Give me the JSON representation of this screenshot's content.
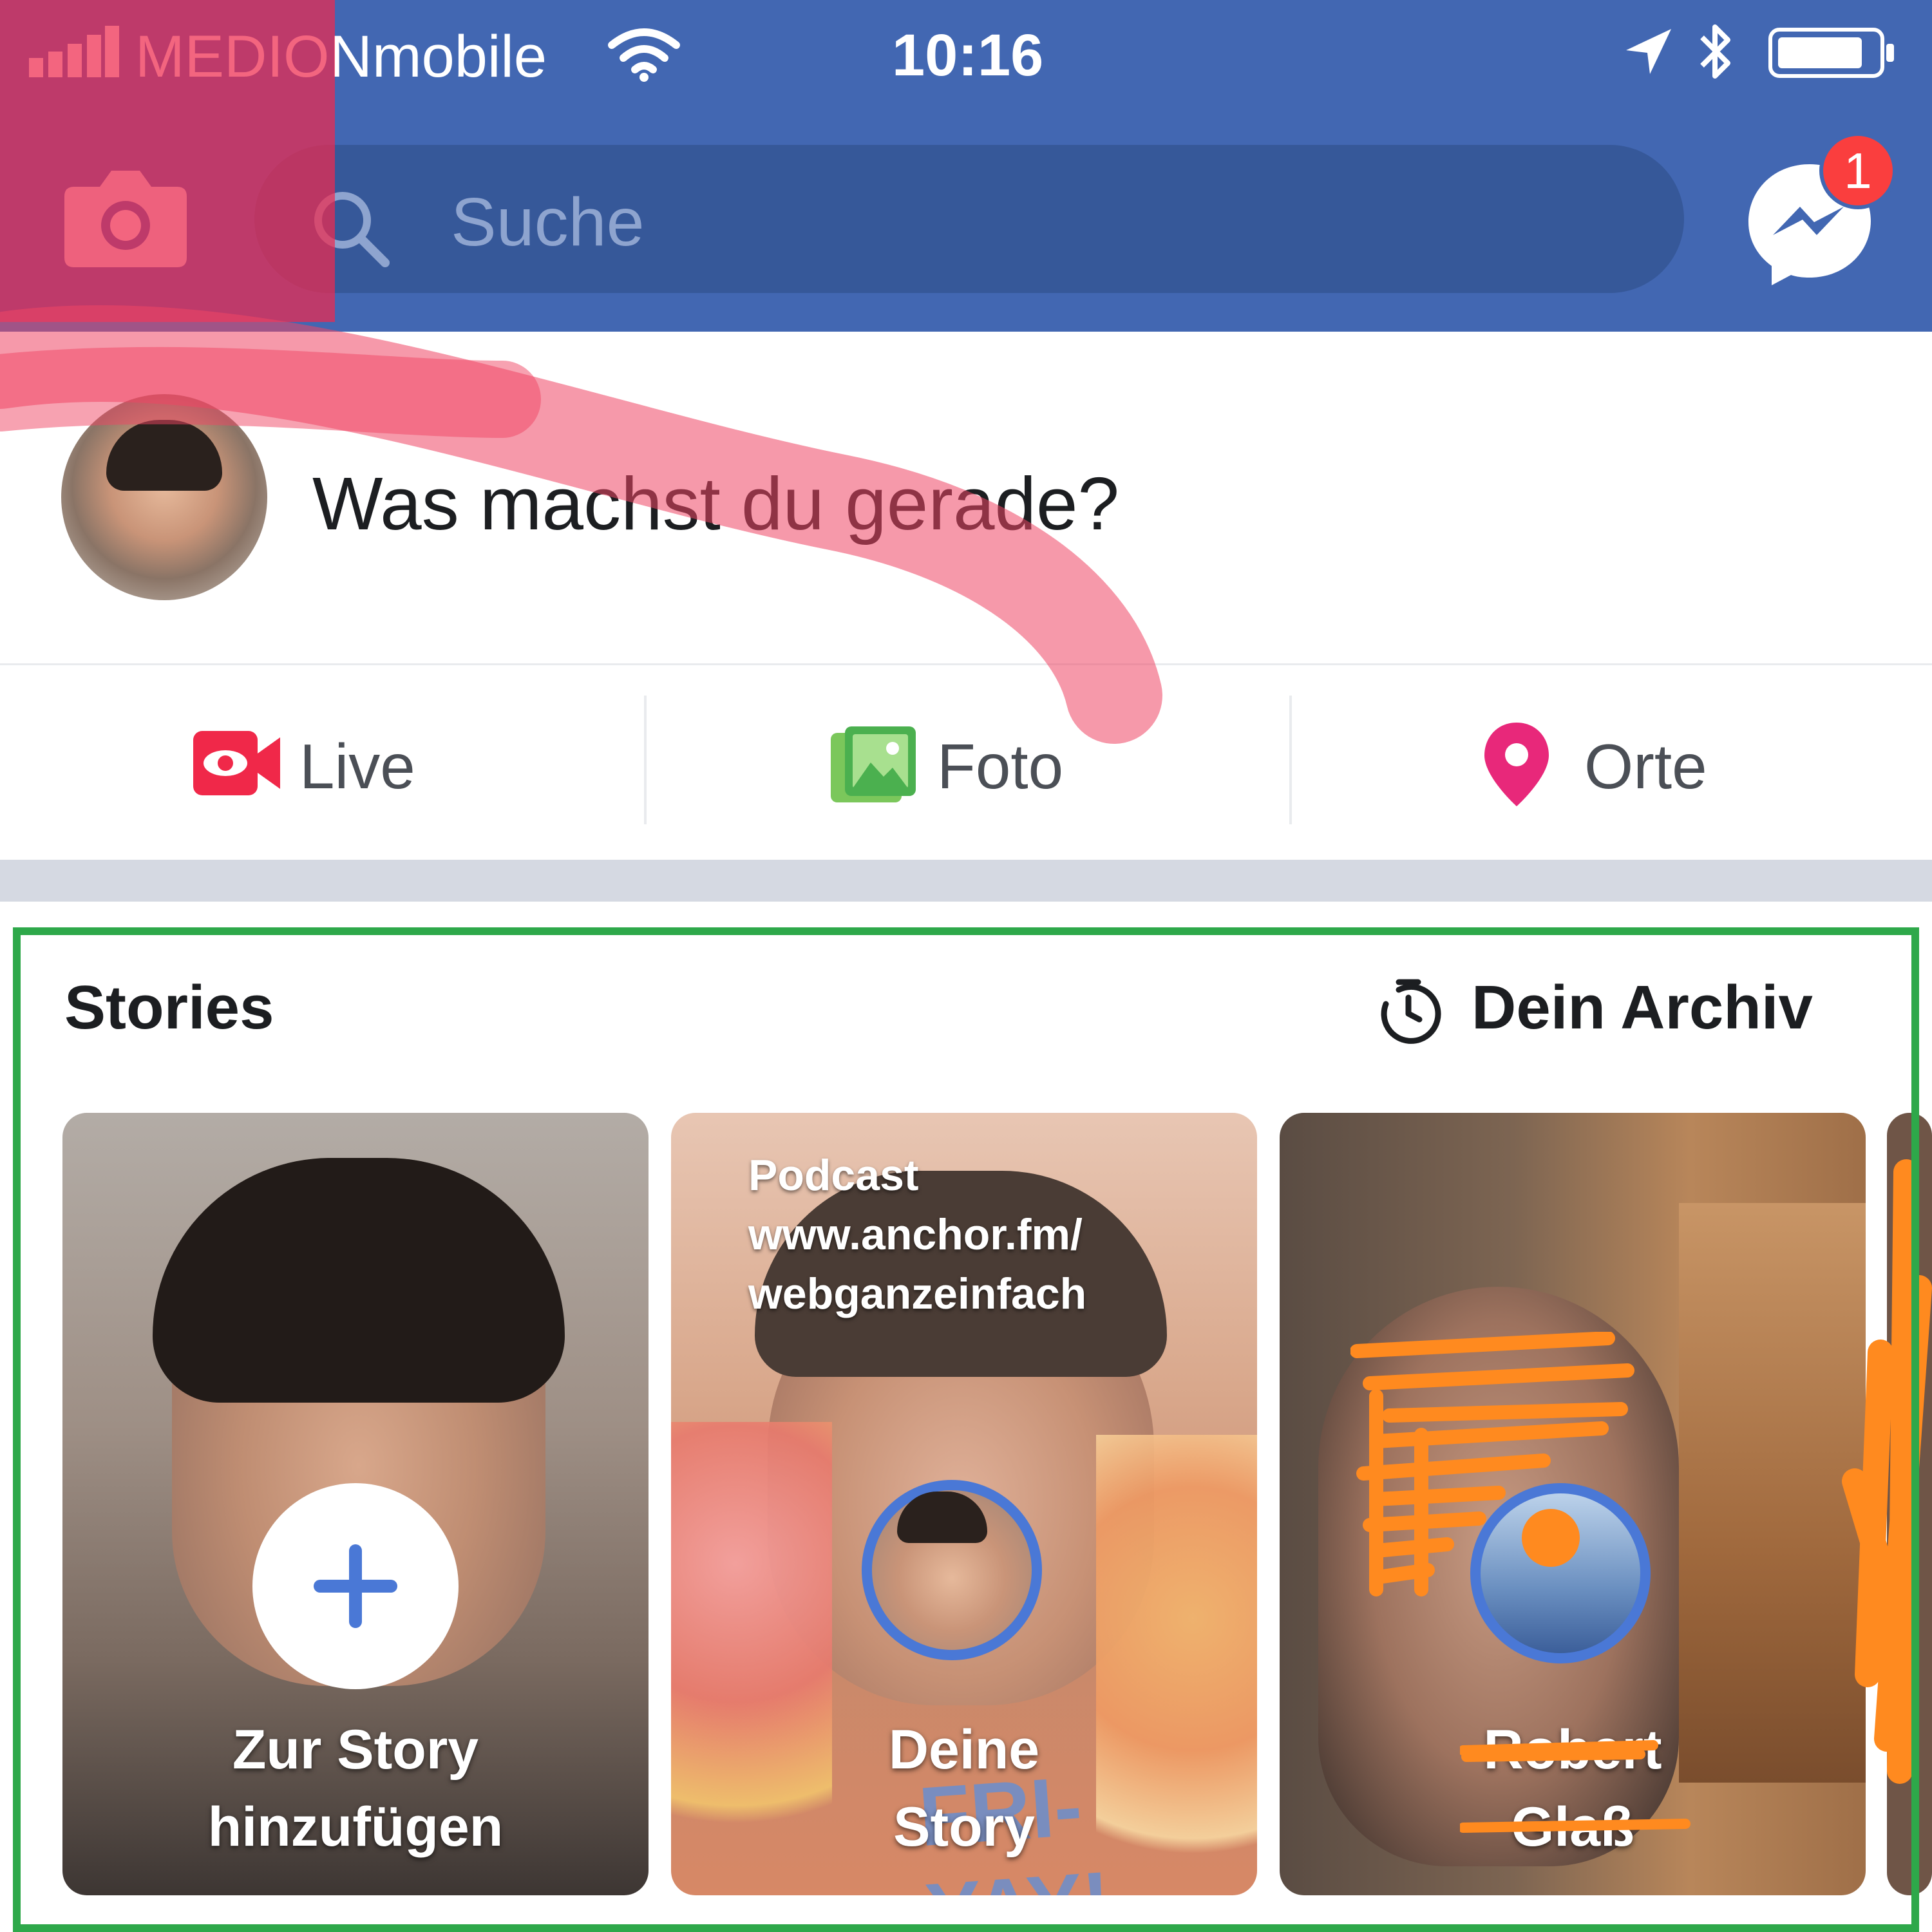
{
  "status_bar": {
    "carrier": "MEDIONmobile",
    "time": "10:16"
  },
  "header": {
    "search_placeholder": "Suche",
    "messenger_badge": "1"
  },
  "composer": {
    "prompt": "Was machst du gerade?"
  },
  "actions": [
    {
      "label": "Live",
      "icon": "live-video-icon"
    },
    {
      "label": "Foto",
      "icon": "photo-icon"
    },
    {
      "label": "Orte",
      "icon": "location-pin-icon"
    }
  ],
  "stories": {
    "title": "Stories",
    "archive_label": "Dein Archiv",
    "cards": [
      {
        "label_line1": "Zur Story",
        "label_line2": "hinzufügen"
      },
      {
        "overlay_line1": "Podcast",
        "overlay_line2": "www.anchor.fm/",
        "overlay_line3": "webganzeinfach",
        "sticker": "FRI-YAY!",
        "label_line1": "Deine",
        "label_line2": "Story"
      },
      {
        "label_line1": "Robert",
        "label_line2": "Glaß"
      }
    ]
  },
  "colors": {
    "brand_blue": "#4267b2",
    "search_bg": "#365899",
    "annotation_red": "#e8394f",
    "annotation_orange": "#ff8a1f",
    "annotation_green": "#2ea84a"
  }
}
